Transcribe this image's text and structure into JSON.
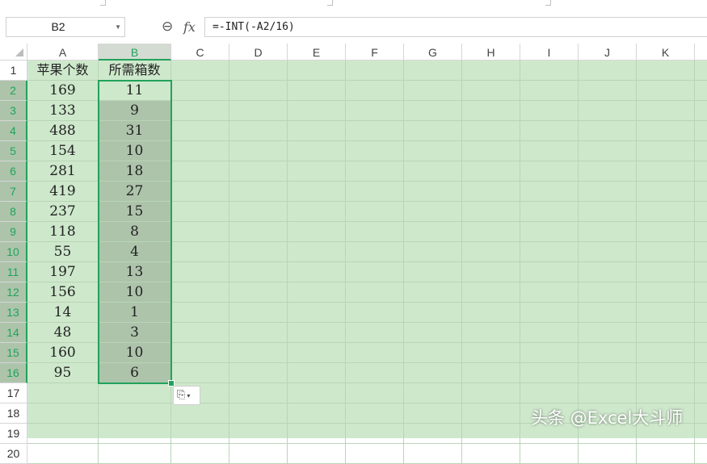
{
  "name_box": {
    "value": "B2",
    "dropdown_icon": "caret-down-icon"
  },
  "formula_bar": {
    "zoom_icon": "zoom-formula-icon",
    "fx_label": "fx",
    "formula": "=-INT(-A2/16)"
  },
  "columns": [
    "A",
    "B",
    "C",
    "D",
    "E",
    "F",
    "G",
    "H",
    "I",
    "J",
    "K"
  ],
  "rows": [
    "1",
    "2",
    "3",
    "4",
    "5",
    "6",
    "7",
    "8",
    "9",
    "10",
    "11",
    "12",
    "13",
    "14",
    "15",
    "16",
    "17",
    "18",
    "19",
    "20"
  ],
  "header_row": {
    "a": "苹果个数",
    "b": "所需箱数"
  },
  "data": [
    {
      "a": "169",
      "b": "11"
    },
    {
      "a": "133",
      "b": "9"
    },
    {
      "a": "488",
      "b": "31"
    },
    {
      "a": "154",
      "b": "10"
    },
    {
      "a": "281",
      "b": "18"
    },
    {
      "a": "419",
      "b": "27"
    },
    {
      "a": "237",
      "b": "15"
    },
    {
      "a": "118",
      "b": "8"
    },
    {
      "a": "55",
      "b": "4"
    },
    {
      "a": "197",
      "b": "13"
    },
    {
      "a": "156",
      "b": "10"
    },
    {
      "a": "14",
      "b": "1"
    },
    {
      "a": "48",
      "b": "3"
    },
    {
      "a": "160",
      "b": "10"
    },
    {
      "a": "95",
      "b": "6"
    }
  ],
  "selection": {
    "active_cell": "B2",
    "range": "B2:B16",
    "accent_color": "#22a25b"
  },
  "colors": {
    "sheet_bg": "#cee8cc",
    "selection_fill": "#adc4ab",
    "accent": "#22a25b"
  },
  "fill_options": {
    "icon": "paste-options-icon",
    "caret": "▾"
  },
  "watermark": "头条 @Excel大斗师"
}
